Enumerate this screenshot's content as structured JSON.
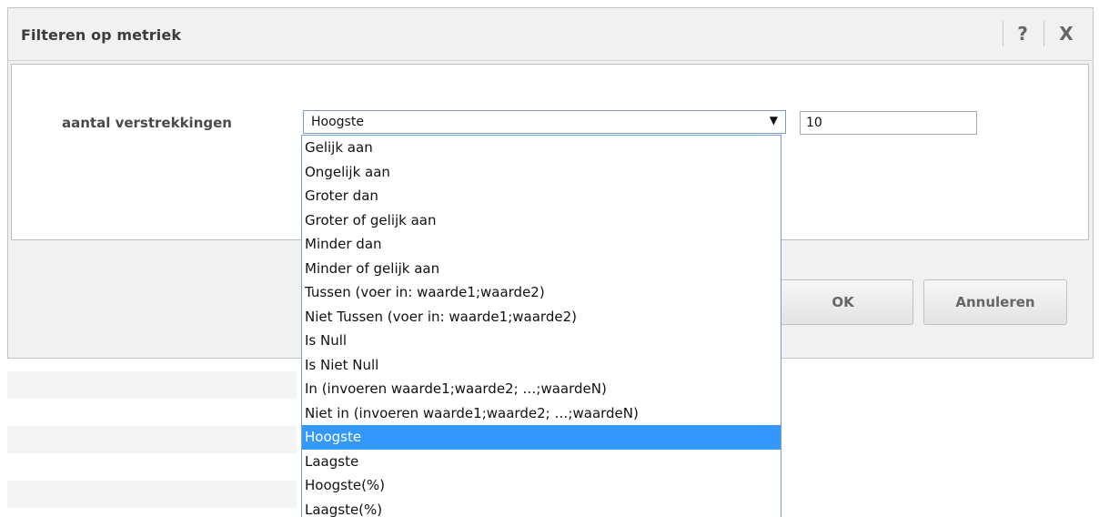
{
  "dialog": {
    "title": "Filteren op metriek",
    "help_label": "?",
    "close_label": "X"
  },
  "filter": {
    "field_label": "aantal verstrekkingen",
    "operator_selected": "Hoogste",
    "arrow": "▼",
    "value": "10"
  },
  "dropdown": {
    "options": [
      "Gelijk aan",
      "Ongelijk aan",
      "Groter dan",
      "Groter of gelijk aan",
      "Minder dan",
      "Minder of gelijk aan",
      "Tussen (voer in: waarde1;waarde2)",
      "Niet Tussen (voer in: waarde1;waarde2)",
      "Is Null",
      "Is Niet Null",
      "In (invoeren waarde1;waarde2; …;waardeN)",
      "Niet in (invoeren waarde1;waarde2; …;waardeN)",
      "Hoogste",
      "Laagste",
      "Hoogste(%)",
      "Laagste(%)"
    ],
    "selected_index": 12
  },
  "buttons": {
    "ok": "OK",
    "cancel": "Annuleren"
  },
  "colors": {
    "highlight": "#3399ff",
    "dialog_bg": "#f1f1f1",
    "select_border": "#7a9cc6"
  }
}
